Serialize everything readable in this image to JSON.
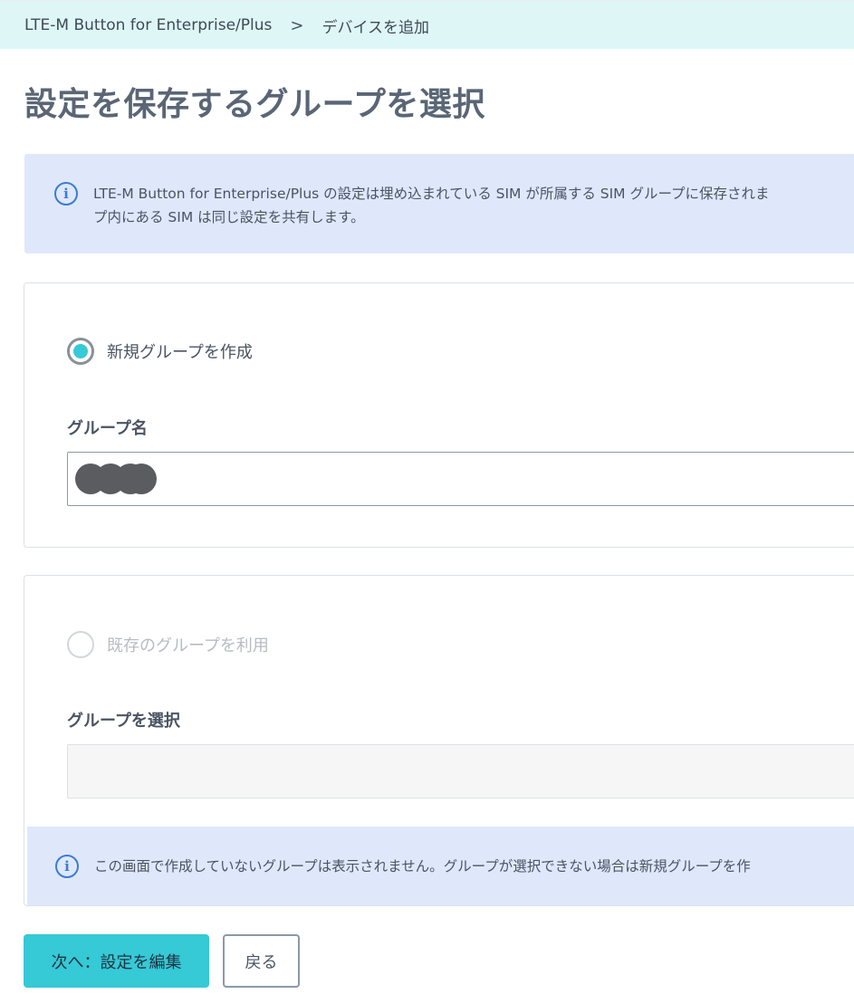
{
  "breadcrumb": {
    "parent": "LTE-M Button for Enterprise/Plus",
    "separator": ">",
    "current": "デバイスを追加"
  },
  "page_title": "設定を保存するグループを選択",
  "info": {
    "icon": "info-icon",
    "line1": "LTE-M Button for Enterprise/Plus の設定は埋め込まれている SIM が所属する SIM グループに保存されま",
    "line2": "プ内にある SIM は同じ設定を共有します。"
  },
  "new_group": {
    "radio_label": "新規グループを作成",
    "selected": true,
    "field_label": "グループ名",
    "value_redacted": true
  },
  "existing_group": {
    "radio_label": "既存のグループを利用",
    "selected": false,
    "disabled": true,
    "field_label": "グループを選択",
    "value": "",
    "notice": "この画面で作成していないグループは表示されません。グループが選択できない場合は新規グループを作"
  },
  "buttons": {
    "next": "次へ：設定を編集",
    "back": "戻る"
  },
  "colors": {
    "accent": "#36c9d6",
    "info_bg": "#dfe8fb",
    "info_icon": "#3b7bd8",
    "breadcrumb_bg": "#dff6f7"
  }
}
